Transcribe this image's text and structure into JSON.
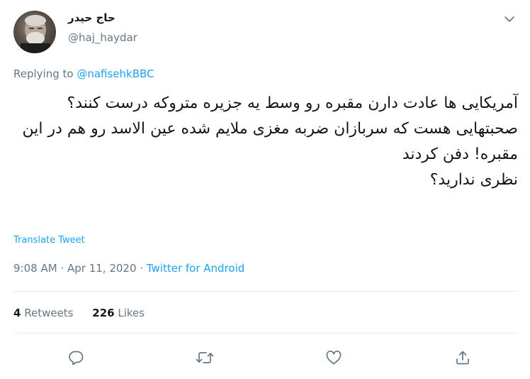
{
  "user": {
    "display_name": "حاج حیدر",
    "handle": "@haj_haydar"
  },
  "reply": {
    "prefix": "Replying to",
    "to": "@nafisehkBBC"
  },
  "tweet": {
    "text": "آمریکایی ها عادت دارن مقبره رو وسط یه جزیره متروکه درست کنند؟\nصحبتهایی هست که سربازان ضربه مغزی ملایم شده عین الاسد رو هم در این مقبره! دفن کردند\nنظری ندارید؟"
  },
  "translate_label": "Translate Tweet",
  "meta": {
    "time": "9:08 AM",
    "separator": "·",
    "date": "Apr 11, 2020",
    "source": "Twitter for Android"
  },
  "stats": {
    "retweets_count": "4",
    "retweets_label": "Retweets",
    "likes_count": "226",
    "likes_label": "Likes"
  },
  "icons": [
    "chevron-down-icon",
    "reply-icon",
    "retweet-icon",
    "like-icon",
    "share-icon"
  ],
  "colors": {
    "accent": "#1da1f2",
    "secondary_text": "#657786",
    "primary_text": "#14171a",
    "divider": "#e6ecf0"
  }
}
